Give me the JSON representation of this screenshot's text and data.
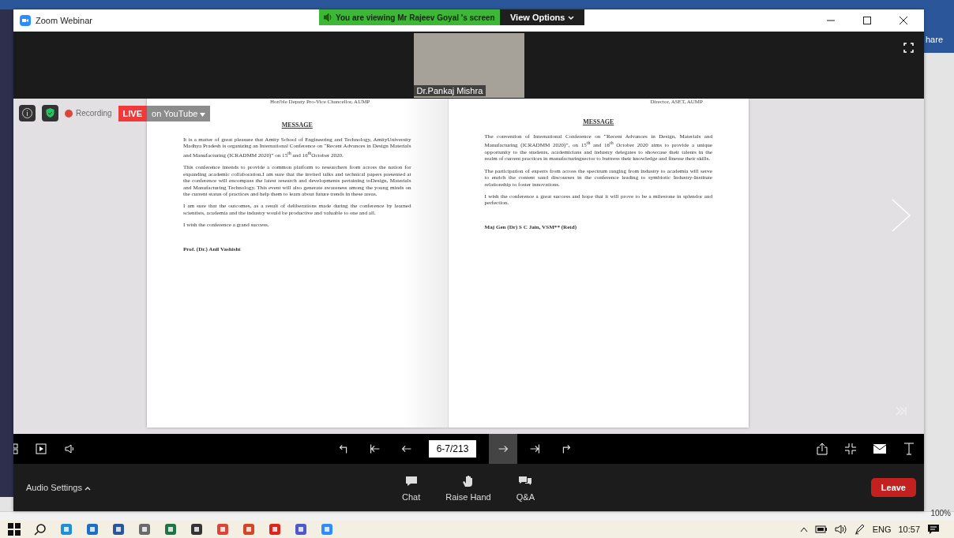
{
  "window": {
    "title": "Zoom Webinar"
  },
  "share_banner": {
    "text": "You are viewing Mr Rajeev Goyal 's screen",
    "button": "View Options"
  },
  "video": {
    "name": "Dr.Pankaj Mishra"
  },
  "status": {
    "recording": "Recording",
    "live": "LIVE",
    "destination": "on YouTube"
  },
  "document": {
    "pages": [
      {
        "header": "Hon'ble Deputy Pro-Vice Chancellor, AUMP",
        "title": "MESSAGE",
        "paragraphs": [
          "It is a matter of great pleasure that Amity School of Engineering and Technology, AmityUniversity Madhya Pradesh is organizing an International Conference on “Recent Advances in Design Materials and Manufacturing (ICRADMM 2020)” on 15$^{th}$ and 16$^{th}$October 2020.",
          "This conference intends to provide a common platform to researchers from across the nation for expanding academic collaboration.I am sure that the invited talks and technical papers presented at the conference will encompass the latest research and developments pertaining toDesign, Materials and Manufacturing Technology. This event will also generate awareness among the young minds on the current status of practices and help them to learn about future trends in these areas.",
          "I am sure that the outcomes, as a result of deliberations made during the conference by learned scientists, academia and the industry would be productive and valuable to one and all.",
          "I wish the conference a grand success."
        ],
        "signature": "Prof. (Dr.) Anil Vashisht"
      },
      {
        "header": "Director, ASET, AUMP",
        "title": "MESSAGE",
        "paragraphs": [
          "The convention of International Conference on “Recent Advances in Design, Materials and Manufacturing (ICRADMM 2020)”, on 15$^{th}$ and 16$^{th}$ October 2020 aims to provide a unique opportunity to the students, academicians and industry delegates to showcase their talents in the realm of current practices in manufacturingsector to buttress their knowledge and finesse their skills.",
          "The participation of experts from across the spectrum ranging from industry to academia will serve to enrich the content sand discourses in the conference leading to symbiotic Industry-Institute relationship to foster innovations.",
          "I wish the conference a great success and hope that it will prove to be a milestone in splendor and perfection."
        ],
        "signature": "Maj Gen (Dr) S C Jain, VSM** (Retd)"
      }
    ]
  },
  "page_nav": {
    "value": "6-7/213",
    "buttons": [
      {
        "hovered": false
      },
      {
        "hovered": false
      },
      {
        "hovered": false
      },
      {
        "hovered": true
      },
      {
        "hovered": false
      },
      {
        "hovered": false
      }
    ]
  },
  "bottom_bar": {
    "audio": "Audio Settings",
    "actions": [
      {
        "kind": "chat",
        "label": "Chat"
      },
      {
        "kind": "hand",
        "label": "Raise Hand"
      },
      {
        "kind": "qa",
        "label": "Q&A"
      }
    ],
    "leave": "Leave"
  },
  "background": {
    "share_label": "hare",
    "zoom_level": "100%"
  },
  "tray": {
    "language": "ENG",
    "time": "10:57"
  }
}
